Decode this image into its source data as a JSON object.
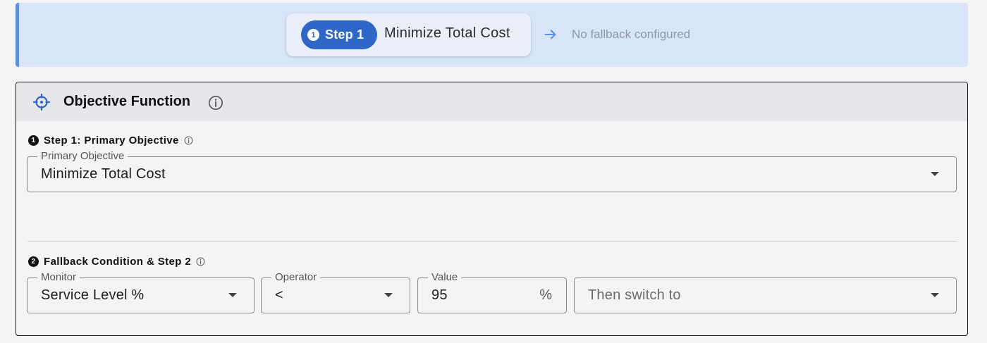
{
  "banner": {
    "step_number": "1",
    "step_label": "Step 1",
    "objective": "Minimize Total Cost",
    "fallback_text": "No fallback configured",
    "arrow_icon": "arrow-right-icon"
  },
  "panel": {
    "title": "Objective Function",
    "header_icon": "target-icon",
    "info_icon": "info-icon"
  },
  "step1": {
    "number": "1",
    "heading": "Step 1: Primary Objective",
    "primary_objective": {
      "label": "Primary Objective",
      "value": "Minimize Total Cost"
    }
  },
  "step2": {
    "number": "2",
    "heading": "Fallback Condition & Step 2",
    "monitor": {
      "label": "Monitor",
      "value": "Service Level %"
    },
    "operator": {
      "label": "Operator",
      "value": "<"
    },
    "value_field": {
      "label": "Value",
      "value": "95",
      "unit": "%"
    },
    "switch_to": {
      "placeholder": "Then switch to"
    }
  },
  "colors": {
    "accent": "#2f67c9",
    "banner_bg": "#d8e4f7",
    "banner_border": "#5b8fe0",
    "muted_text": "#8e97a8"
  }
}
